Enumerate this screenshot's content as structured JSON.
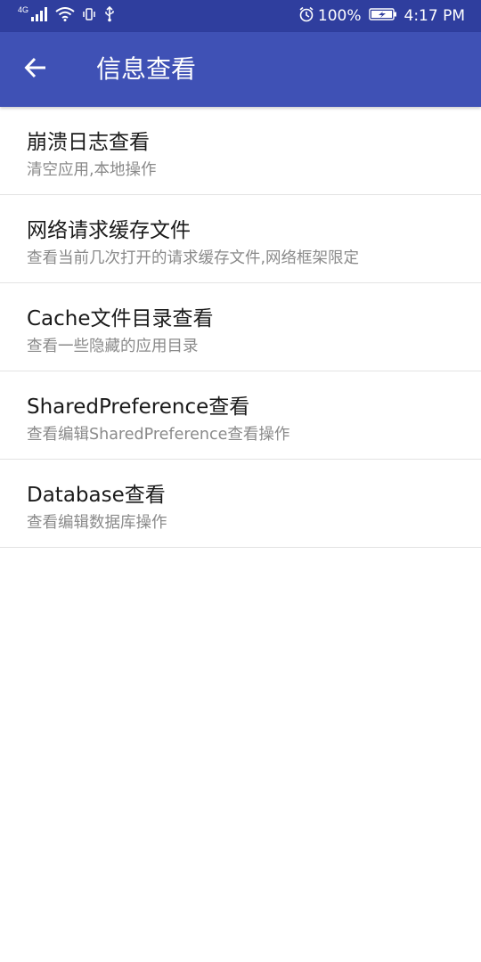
{
  "status_bar": {
    "network_type": "4G",
    "battery": "100%",
    "time": "4:17 PM",
    "icons": [
      "signal-icon",
      "wifi-icon",
      "vibrate-icon",
      "usb-icon",
      "alarm-icon",
      "battery-charging-icon"
    ]
  },
  "app_bar": {
    "title": "信息查看",
    "back_icon": "arrow-back-icon",
    "background_color": "#3f51b5"
  },
  "items": [
    {
      "title": "崩溃日志查看",
      "subtitle": "清空应用,本地操作"
    },
    {
      "title": "网络请求缓存文件",
      "subtitle": "查看当前几次打开的请求缓存文件,网络框架限定"
    },
    {
      "title": "Cache文件目录查看",
      "subtitle": "查看一些隐藏的应用目录"
    },
    {
      "title": "SharedPreference查看",
      "subtitle": "查看编辑SharedPreference查看操作"
    },
    {
      "title": "Database查看",
      "subtitle": "查看编辑数据库操作"
    }
  ]
}
